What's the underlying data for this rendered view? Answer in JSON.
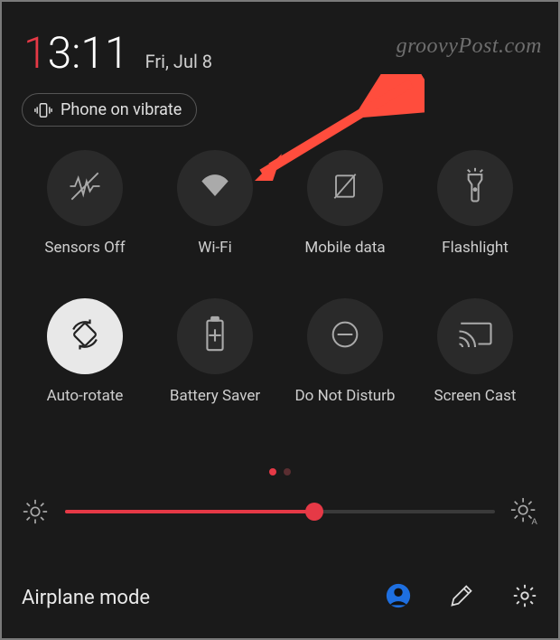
{
  "header": {
    "time_hours_accent": "1",
    "time_rest": "3:11",
    "date": "Fri, Jul 8",
    "watermark": "groovyPost.com"
  },
  "vibrate": {
    "label": "Phone on vibrate"
  },
  "tiles": [
    {
      "id": "sensors-off",
      "label": "Sensors Off",
      "active": false
    },
    {
      "id": "wifi",
      "label": "Wi-Fi",
      "active": false
    },
    {
      "id": "mobile-data",
      "label": "Mobile data",
      "active": false
    },
    {
      "id": "flashlight",
      "label": "Flashlight",
      "active": false
    },
    {
      "id": "auto-rotate",
      "label": "Auto-rotate",
      "active": true
    },
    {
      "id": "battery-saver",
      "label": "Battery Saver",
      "active": false
    },
    {
      "id": "dnd",
      "label": "Do Not Disturb",
      "active": false
    },
    {
      "id": "screen-cast",
      "label": "Screen Cast",
      "active": false
    }
  ],
  "pagination": {
    "count": 2,
    "active_index": 0
  },
  "brightness": {
    "percent": 58
  },
  "bottom": {
    "airplane_label": "Airplane mode"
  },
  "colors": {
    "accent": "#e63946",
    "bg": "#1a1a1a"
  }
}
